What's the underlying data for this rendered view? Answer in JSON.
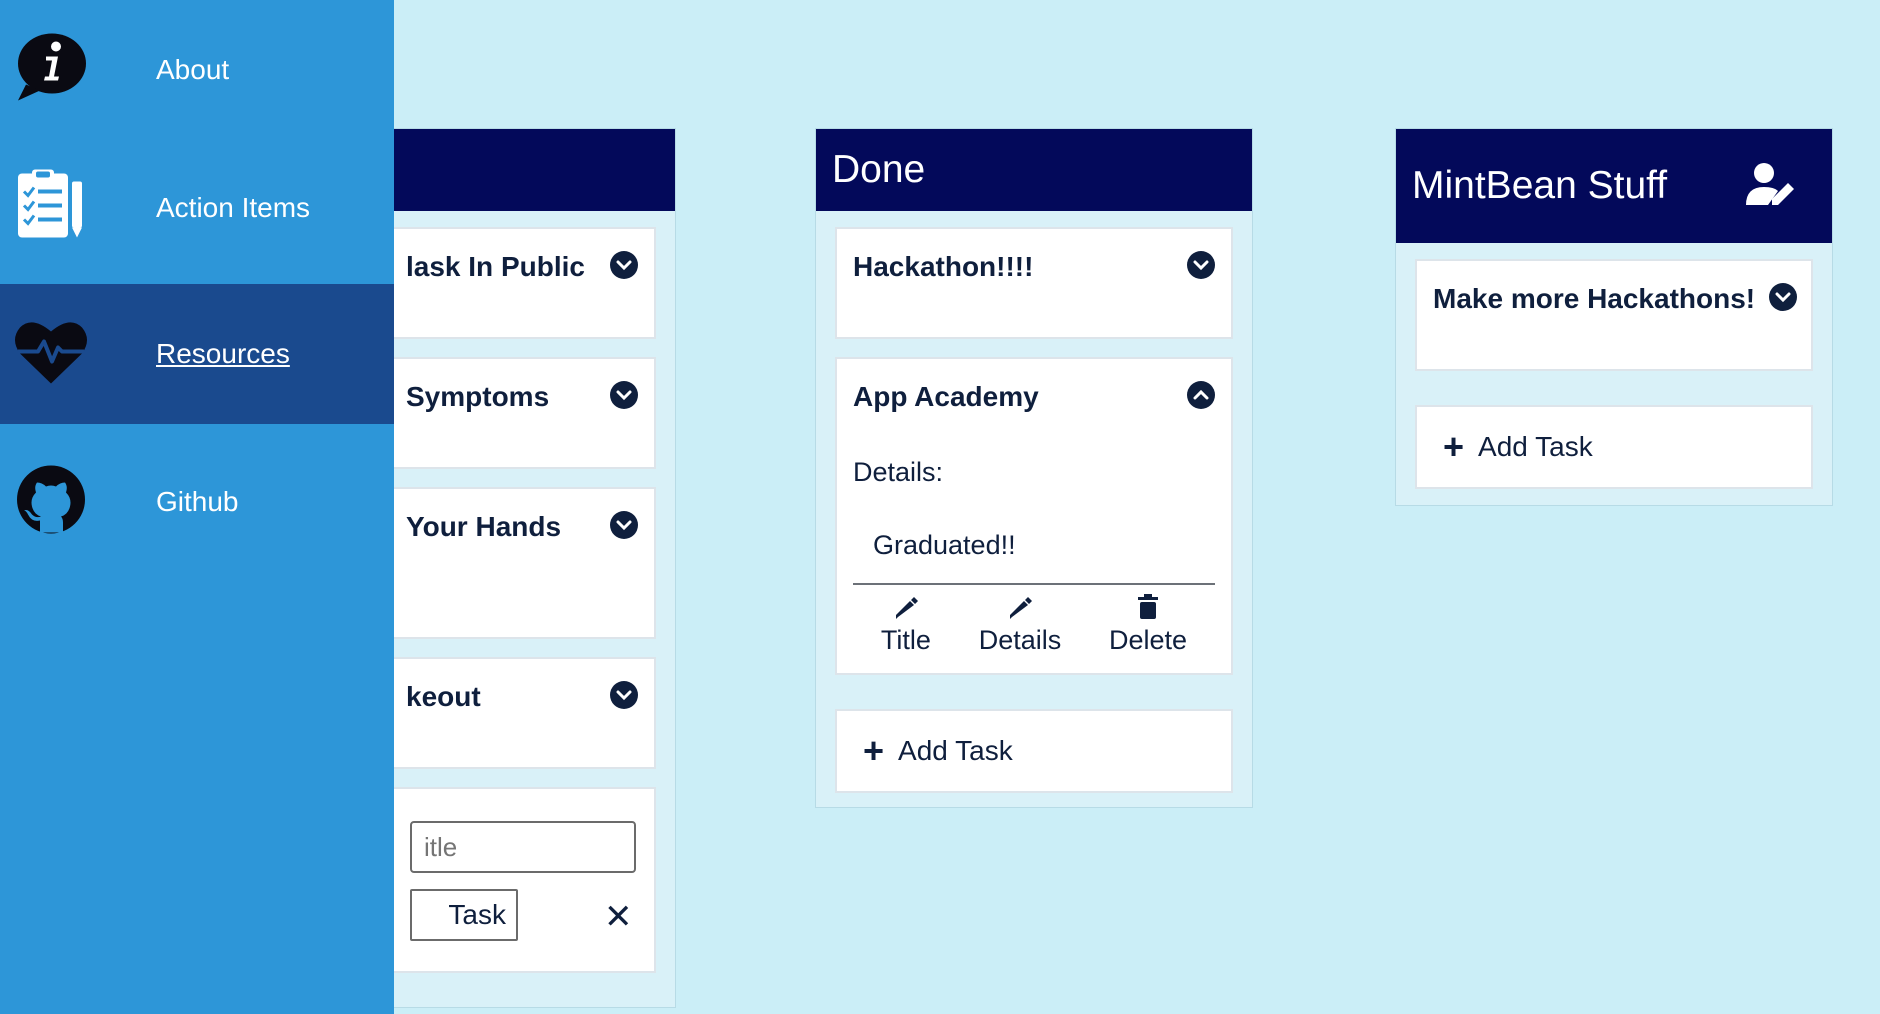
{
  "sidebar": {
    "items": [
      {
        "label": "About",
        "icon": "info-bubble-icon"
      },
      {
        "label": "Action Items",
        "icon": "clipboard-list-icon"
      },
      {
        "label": "Resources",
        "icon": "heartbeat-icon",
        "active": true
      },
      {
        "label": "Github",
        "icon": "github-icon"
      }
    ]
  },
  "columns": {
    "left": {
      "title": "",
      "cards": [
        {
          "title": "lask In Public"
        },
        {
          "title": "Symptoms"
        },
        {
          "title": " Your Hands"
        },
        {
          "title": "keout"
        }
      ],
      "form": {
        "title_placeholder": "itle",
        "add_button_label": "Task",
        "close_icon": "close-icon"
      }
    },
    "done": {
      "title": "Done",
      "cards": [
        {
          "title": "Hackathon!!!!",
          "expanded": false
        },
        {
          "title": "App Academy",
          "expanded": true,
          "details_label": "Details:",
          "details_text": "Graduated!!",
          "actions": {
            "title": "Title",
            "details": "Details",
            "delete": "Delete"
          }
        }
      ],
      "add_task_label": "Add Task"
    },
    "mintbean": {
      "title": "MintBean Stuff",
      "header_icon": "user-edit-icon",
      "cards": [
        {
          "title": "Make more Hackathons!"
        }
      ],
      "add_task_label": "Add Task"
    }
  },
  "colors": {
    "sidebar": "#2d96d8",
    "sidebar_active": "#1a4a8e",
    "column_header": "#03095a",
    "page_background": "#cbeef7",
    "text": "#0f1f3d"
  }
}
